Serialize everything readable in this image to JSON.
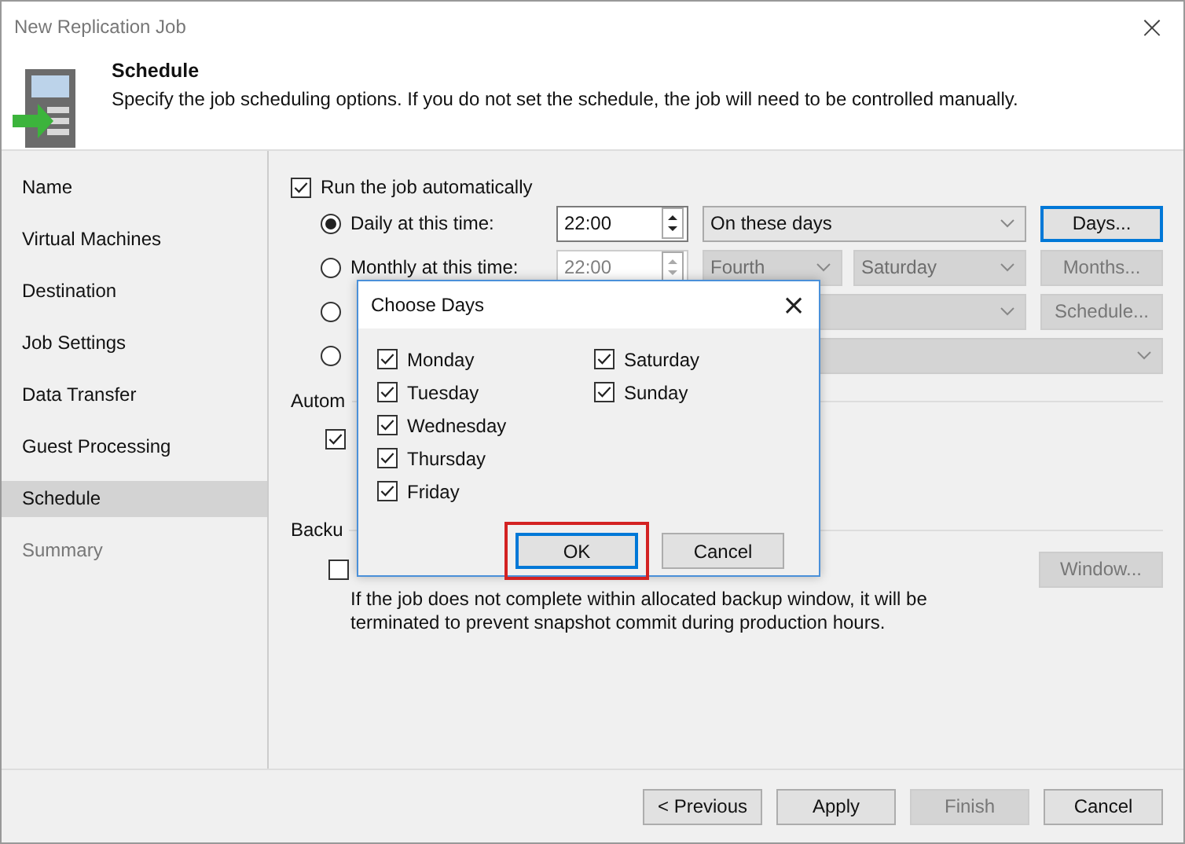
{
  "window": {
    "title": "New Replication Job",
    "close": "×"
  },
  "header": {
    "title": "Schedule",
    "description": "Specify the job scheduling options. If you do not set the schedule, the job will need to be controlled manually."
  },
  "sidebar": {
    "items": [
      {
        "label": "Name",
        "selected": false,
        "disabled": false
      },
      {
        "label": "Virtual Machines",
        "selected": false,
        "disabled": false
      },
      {
        "label": "Destination",
        "selected": false,
        "disabled": false
      },
      {
        "label": "Job Settings",
        "selected": false,
        "disabled": false
      },
      {
        "label": "Data Transfer",
        "selected": false,
        "disabled": false
      },
      {
        "label": "Guest Processing",
        "selected": false,
        "disabled": false
      },
      {
        "label": "Schedule",
        "selected": true,
        "disabled": false
      },
      {
        "label": "Summary",
        "selected": false,
        "disabled": true
      }
    ]
  },
  "schedule": {
    "run_automatically": {
      "label": "Run the job automatically",
      "checked": true
    },
    "options": [
      {
        "selected": true,
        "label": "Daily at this time:",
        "time": {
          "value": "22:00",
          "disabled": false
        },
        "dropdowns": [
          {
            "value": "On these days",
            "disabled": false
          }
        ],
        "button": {
          "label": "Days...",
          "disabled": false
        }
      },
      {
        "selected": false,
        "label": "Monthly at this time:",
        "time": {
          "value": "22:00",
          "disabled": true
        },
        "dropdowns": [
          {
            "value": "Fourth",
            "disabled": true
          },
          {
            "value": "Saturday",
            "disabled": true
          }
        ],
        "button": {
          "label": "Months...",
          "disabled": true
        }
      },
      {
        "selected": false,
        "dropdowns": [
          {
            "disabled": true
          }
        ],
        "button": {
          "label": "Schedule...",
          "disabled": true
        }
      },
      {
        "selected": false,
        "dropdowns": [
          {
            "disabled": true
          }
        ]
      }
    ],
    "retry": {
      "heading": "Autom",
      "checked": true
    },
    "backup_window": {
      "heading": "Backu",
      "checked": false,
      "button": {
        "label": "Window...",
        "disabled": true
      },
      "note": "If the job does not complete within allocated backup window, it will be terminated to prevent snapshot commit during production hours."
    }
  },
  "dialog": {
    "title": "Choose Days",
    "close": "×",
    "days": [
      {
        "label": "Monday",
        "checked": true
      },
      {
        "label": "Tuesday",
        "checked": true
      },
      {
        "label": "Wednesday",
        "checked": true
      },
      {
        "label": "Thursday",
        "checked": true
      },
      {
        "label": "Friday",
        "checked": true
      },
      {
        "label": "Saturday",
        "checked": true
      },
      {
        "label": "Sunday",
        "checked": true
      }
    ],
    "buttons": [
      {
        "label": "OK",
        "default": true,
        "highlighted": true
      },
      {
        "label": "Cancel",
        "default": false,
        "highlighted": false
      }
    ]
  },
  "footer": {
    "buttons": [
      {
        "label": "< Previous",
        "disabled": false
      },
      {
        "label": "Apply",
        "disabled": false
      },
      {
        "label": "Finish",
        "disabled": true
      },
      {
        "label": "Cancel",
        "disabled": false
      }
    ]
  }
}
